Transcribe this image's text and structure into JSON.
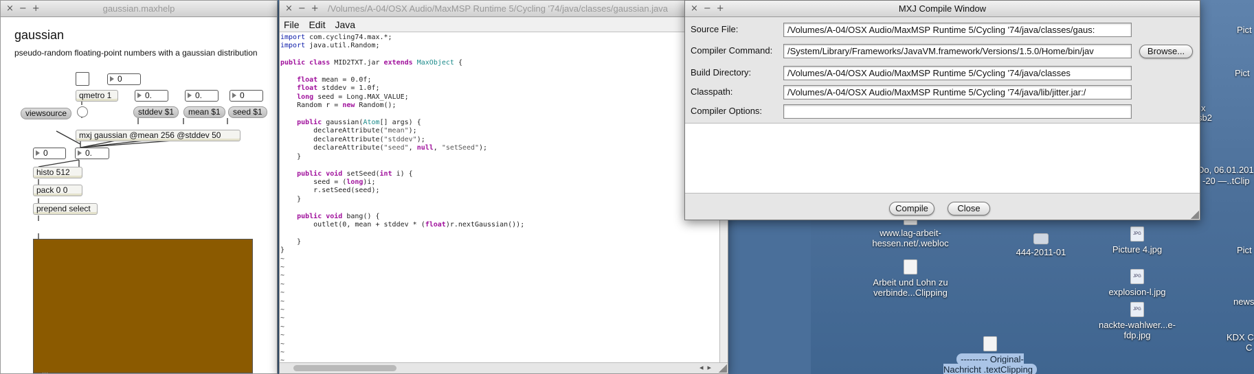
{
  "desktop": {
    "icons": [
      {
        "label": "www.lag-arbeit-hessen.net/.webloc",
        "kind": "doc"
      },
      {
        "label": "444-2011-01",
        "kind": "folder"
      },
      {
        "label": "Picture 4.jpg",
        "kind": "jpg"
      },
      {
        "label": "Arbeit und Lohn zu verbinde...Clipping",
        "kind": "doc"
      },
      {
        "label": "explosion-l.jpg",
        "kind": "jpg"
      },
      {
        "label": "nackte-wahlwer...e-fdp.jpg",
        "kind": "jpg"
      },
      {
        "label": "--------- Original-Nachricht .textClipping",
        "kind": "doc"
      }
    ],
    "edge_labels": [
      "Pict",
      "Pict",
      "x",
      "sb2",
      "Do, 06.01.201",
      "-20 —..tClip",
      "Pict",
      "news",
      "KDX C",
      "C"
    ]
  },
  "patcher": {
    "title": "gaussian.maxhelp",
    "heading": "gaussian",
    "subtitle": "pseudo-random floating-point numbers with a gaussian distribution",
    "objects": {
      "num_top": "0",
      "qmetro": "qmetro 1",
      "num_stddev": "0.",
      "num_mean": "0.",
      "num_seed": "0",
      "msg_viewsource": "viewsource",
      "msg_stddev": "stddev $1",
      "msg_mean": "mean $1",
      "msg_seed": "seed $1",
      "mxj": "mxj gaussian @mean 256 @stddev 50",
      "num_int_out": "0",
      "num_float_out": "0.",
      "histo": "histo 512",
      "pack": "pack 0 0",
      "prepend": "prepend select"
    },
    "lcd_color": "#8b5a00",
    "footer_fragment": "..."
  },
  "editor": {
    "title": "/Volumes/A-04/OSX Audio/MaxMSP Runtime 5/Cycling '74/java/classes/gaussian.java",
    "menu": [
      "File",
      "Edit",
      "Java"
    ]
  },
  "compile": {
    "title": "MXJ Compile Window",
    "labels": {
      "source": "Source File:",
      "command": "Compiler Command:",
      "build": "Build Directory:",
      "classpath": "Classpath:",
      "options": "Compiler Options:"
    },
    "values": {
      "source": "/Volumes/A-04/OSX Audio/MaxMSP Runtime 5/Cycling '74/java/classes/gaus:",
      "command": "/System/Library/Frameworks/JavaVM.framework/Versions/1.5.0/Home/bin/jav",
      "build": "/Volumes/A-04/OSX Audio/MaxMSP Runtime 5/Cycling '74/java/classes",
      "classpath": "/Volumes/A-04/OSX Audio/MaxMSP Runtime 5/Cycling '74/java/lib/jitter.jar:/",
      "options": ""
    },
    "buttons": {
      "browse": "Browse...",
      "compile": "Compile",
      "close": "Close"
    }
  },
  "window_controls": "×−+"
}
